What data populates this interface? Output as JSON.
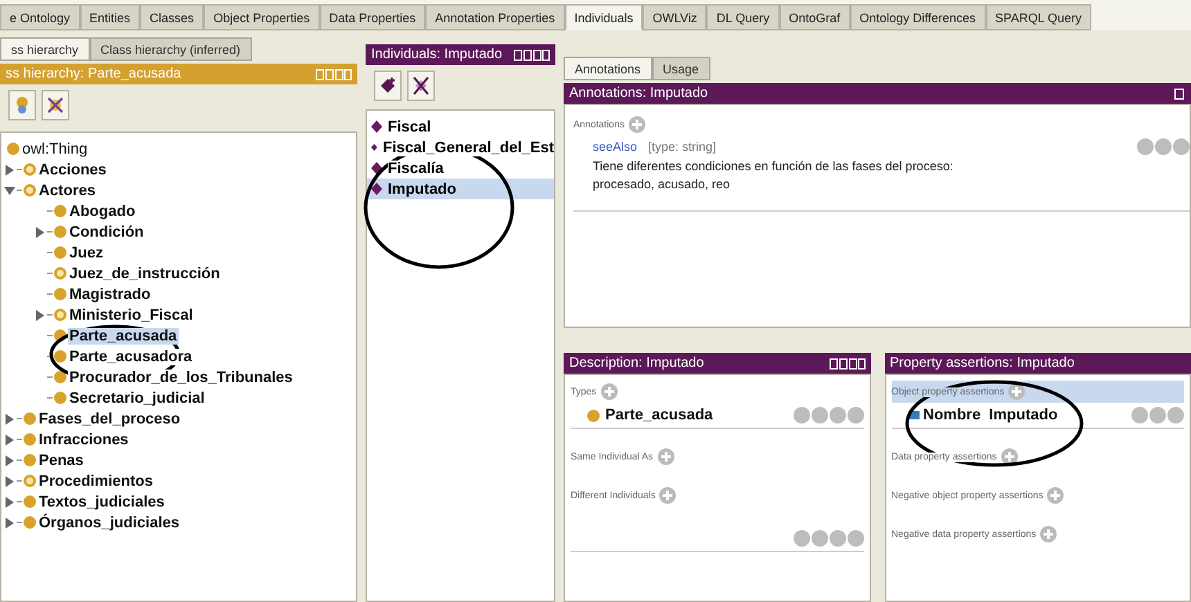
{
  "tabs": [
    {
      "label": "e Ontology",
      "selected": false
    },
    {
      "label": "Entities",
      "selected": false
    },
    {
      "label": "Classes",
      "selected": false
    },
    {
      "label": "Object Properties",
      "selected": false
    },
    {
      "label": "Data Properties",
      "selected": false
    },
    {
      "label": "Annotation Properties",
      "selected": false
    },
    {
      "label": "Individuals",
      "selected": true
    },
    {
      "label": "OWLViz",
      "selected": false
    },
    {
      "label": "DL Query",
      "selected": false
    },
    {
      "label": "OntoGraf",
      "selected": false
    },
    {
      "label": "Ontology Differences",
      "selected": false
    },
    {
      "label": "SPARQL Query",
      "selected": false
    }
  ],
  "class_panel": {
    "tabs": [
      {
        "label": "ss hierarchy",
        "selected": true
      },
      {
        "label": "Class hierarchy (inferred)",
        "selected": false
      }
    ],
    "title": "ss hierarchy: Parte_acusada",
    "tree": [
      {
        "label": "owl:Thing",
        "kind": "plain",
        "selected": false,
        "children": [
          {
            "label": "Acciones",
            "kind": "hollow",
            "selected": false,
            "expanded": false
          },
          {
            "label": "Actores",
            "kind": "hollow",
            "selected": false,
            "expanded": true,
            "children": [
              {
                "label": "Abogado",
                "kind": "plain",
                "selected": false
              },
              {
                "label": "Condición",
                "kind": "plain",
                "selected": false,
                "expanded": false
              },
              {
                "label": "Juez",
                "kind": "plain",
                "selected": false
              },
              {
                "label": "Juez_de_instrucción",
                "kind": "hollow",
                "selected": false
              },
              {
                "label": "Magistrado",
                "kind": "plain",
                "selected": false
              },
              {
                "label": "Ministerio_Fiscal",
                "kind": "hollow",
                "selected": false,
                "expanded": false
              },
              {
                "label": "Parte_acusada",
                "kind": "plain",
                "selected": true
              },
              {
                "label": "Parte_acusadora",
                "kind": "plain",
                "selected": false
              },
              {
                "label": "Procurador_de_los_Tribunales",
                "kind": "plain",
                "selected": false
              },
              {
                "label": "Secretario_judicial",
                "kind": "plain",
                "selected": false
              }
            ]
          },
          {
            "label": "Fases_del_proceso",
            "kind": "plain",
            "selected": false,
            "expanded": false
          },
          {
            "label": "Infracciones",
            "kind": "plain",
            "selected": false,
            "expanded": false
          },
          {
            "label": "Penas",
            "kind": "plain",
            "selected": false,
            "expanded": false
          },
          {
            "label": "Procedimientos",
            "kind": "hollow",
            "selected": false,
            "expanded": false
          },
          {
            "label": "Textos_judiciales",
            "kind": "plain",
            "selected": false,
            "expanded": false
          },
          {
            "label": "Órganos_judiciales",
            "kind": "plain",
            "selected": false,
            "expanded": false
          }
        ]
      }
    ]
  },
  "individuals_panel": {
    "title": "Individuals: Imputado",
    "items": [
      {
        "label": "Fiscal",
        "selected": false
      },
      {
        "label": "Fiscal_General_del_Est",
        "selected": false
      },
      {
        "label": "Fiscalía",
        "selected": false
      },
      {
        "label": "Imputado",
        "selected": true
      }
    ]
  },
  "annotations_panel": {
    "tabs": [
      {
        "label": "Annotations",
        "selected": true
      },
      {
        "label": "Usage",
        "selected": false
      }
    ],
    "title": "Annotations: Imputado",
    "section": "Annotations",
    "annotations": [
      {
        "property": "seeAlso",
        "type": "[type: string]",
        "lines": [
          "Tiene diferentes condiciones en función de las fases del proceso:",
          "procesado, acusado, reo"
        ]
      }
    ]
  },
  "description_panel": {
    "title": "Description: Imputado",
    "sections": [
      {
        "label": "Types",
        "items": [
          "Parte_acusada"
        ]
      },
      {
        "label": "Same Individual As"
      },
      {
        "label": "Different Individuals"
      }
    ]
  },
  "property_panel": {
    "title": "Property assertions: Imputado",
    "sections": [
      {
        "label": "Object property assertions",
        "highlighted": true,
        "items": [
          "Nombre  Imputado"
        ]
      },
      {
        "label": "Data property assertions",
        "highlighted": false
      },
      {
        "label": "Negative object property assertions",
        "highlighted": false
      },
      {
        "label": "Negative data property assertions",
        "highlighted": false
      }
    ]
  }
}
